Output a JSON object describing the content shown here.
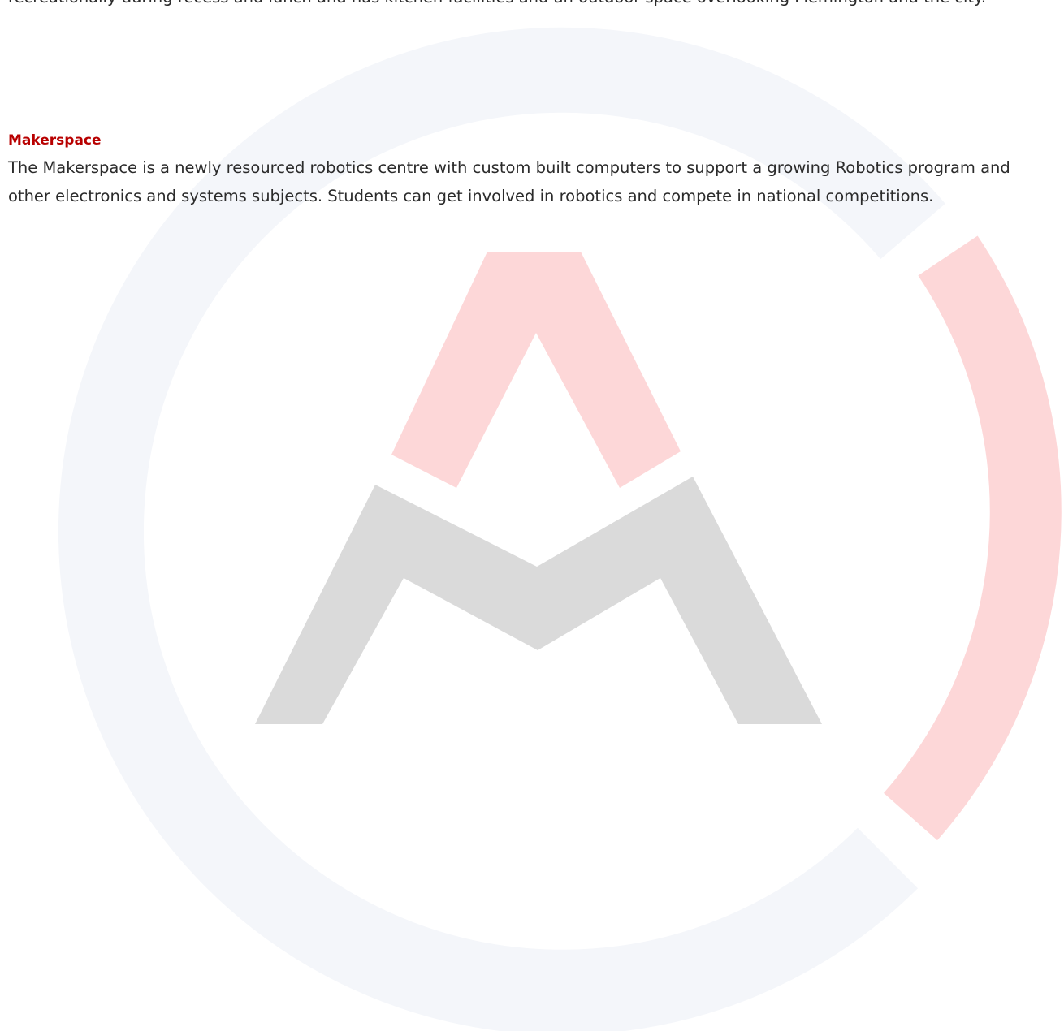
{
  "document": {
    "intro_paragraph": "recreationally during recess and lunch and has kitchen facilities and an outdoor space overlooking Flemington and the city.",
    "makerspace": {
      "heading": "Makerspace",
      "body": "The Makerspace is a newly resourced robotics centre with custom built computers to support a growing Robotics program and other electronics and systems subjects. Students can get involved in robotics and compete in national competitions."
    }
  },
  "colors": {
    "heading": "#b80000",
    "body_text": "#2b2b2b",
    "watermark_ring": "#f4f6fa",
    "watermark_red": "#fdd7d8",
    "watermark_grey": "#dadada"
  },
  "watermark": {
    "icon": "school-logo-watermark"
  }
}
